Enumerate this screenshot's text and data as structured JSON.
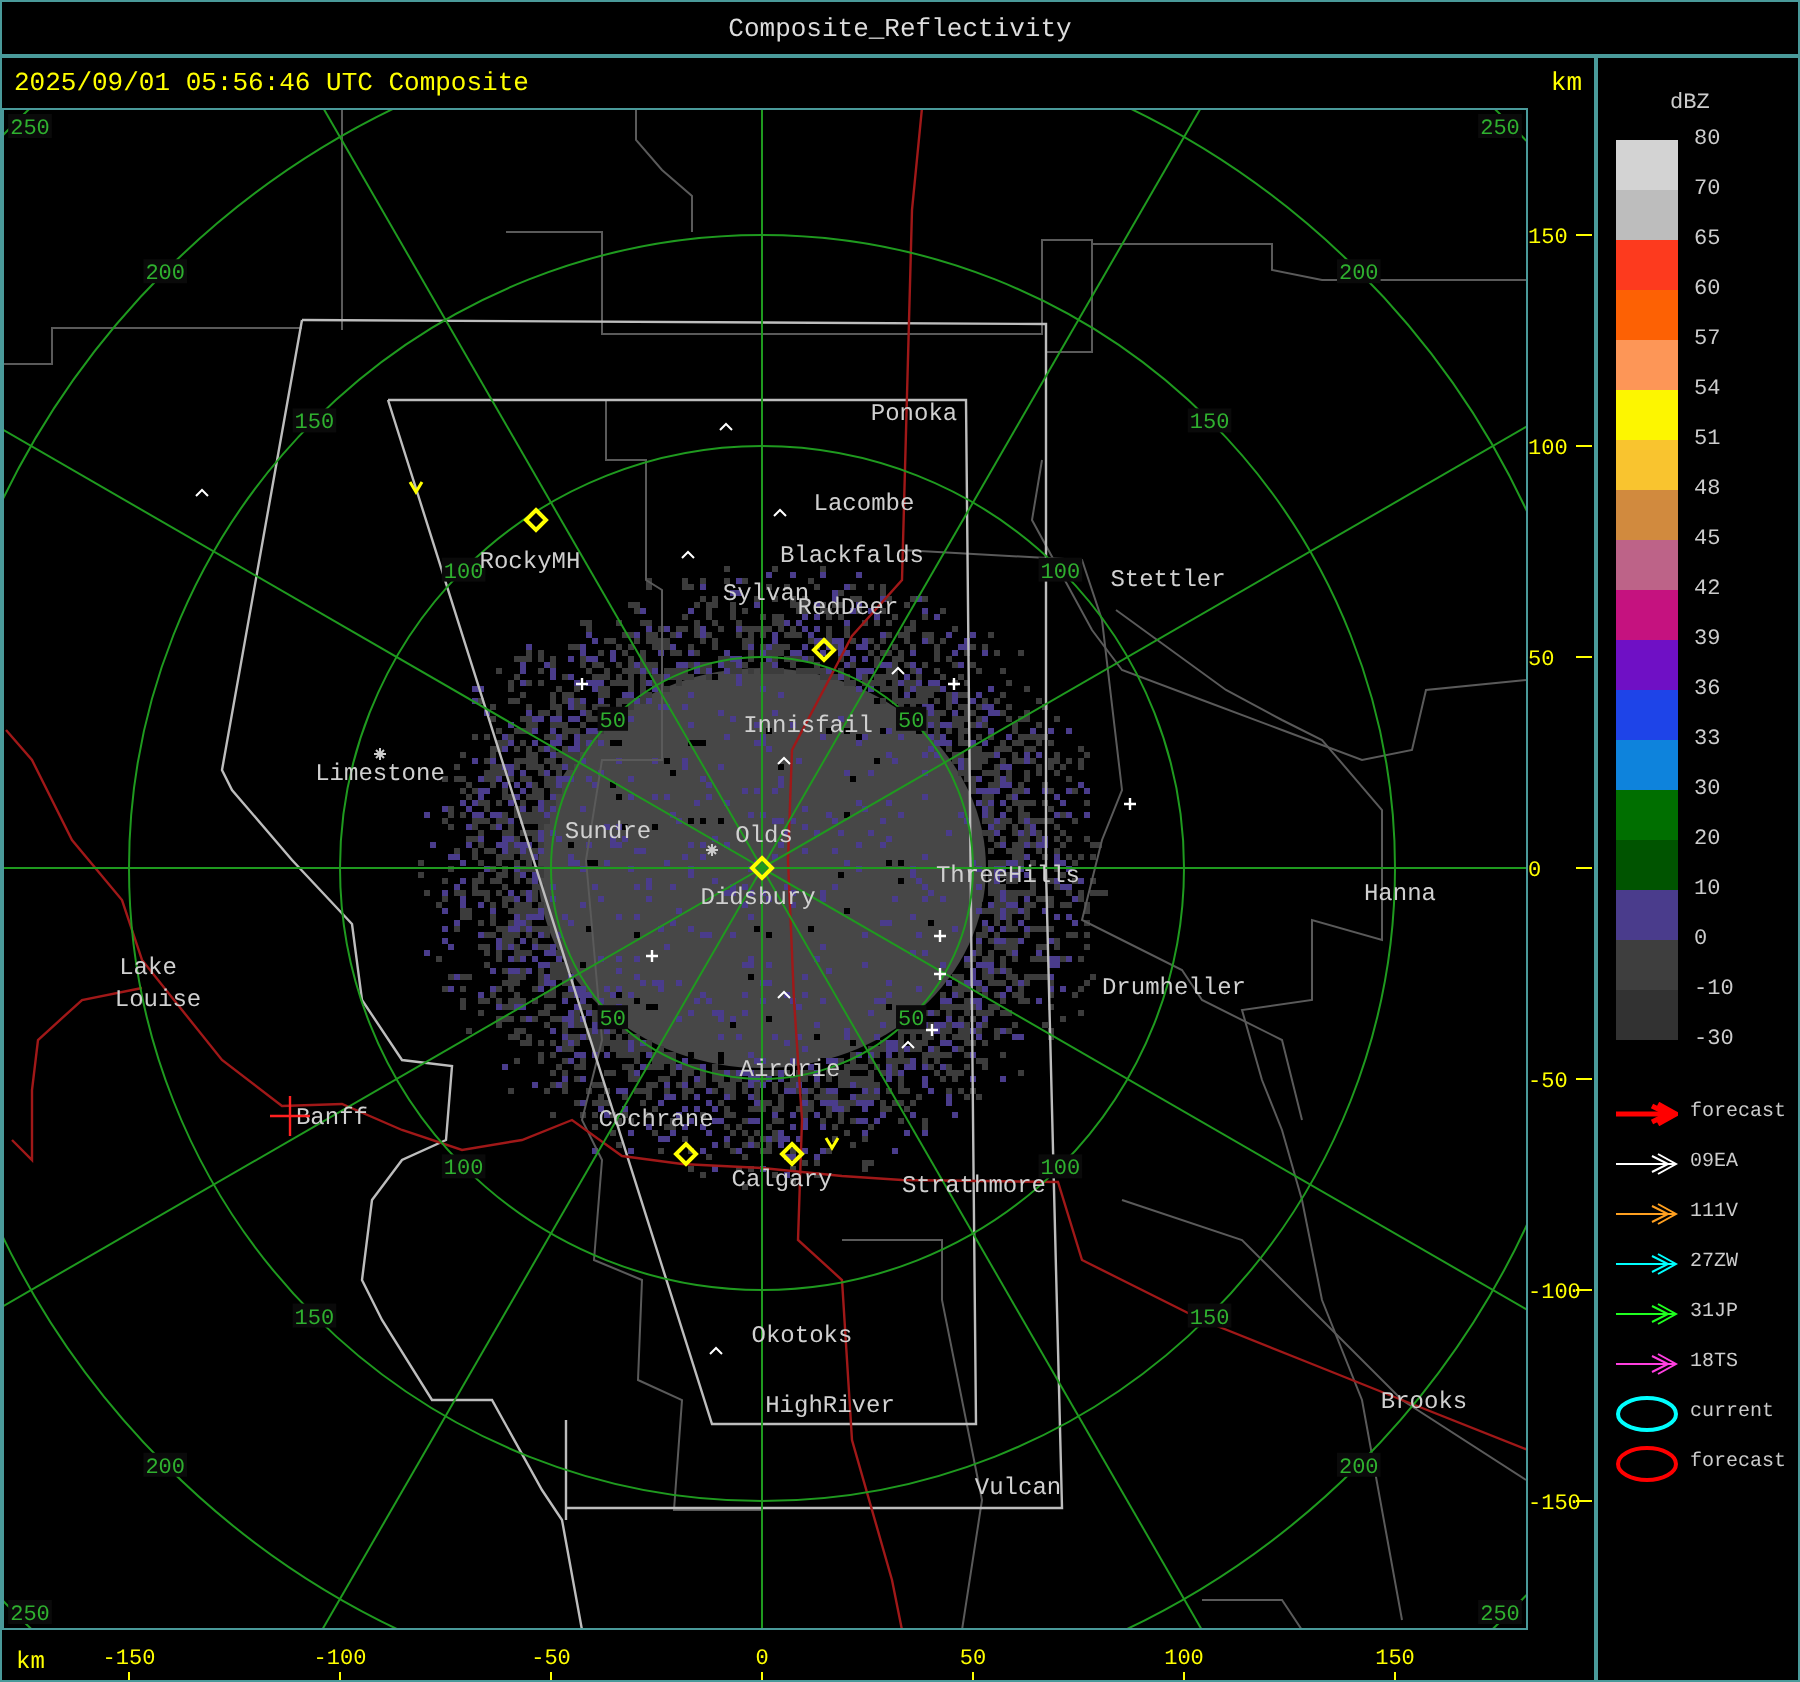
{
  "window": {
    "title": "Composite_Reflectivity"
  },
  "header": {
    "timestamp": "2025/09/01 05:56:46 UTC Composite",
    "axis_unit": "km"
  },
  "map": {
    "places": [
      "Ponoka",
      "Lacombe",
      "Blackfalds",
      "Sylvan",
      "RedDeer",
      "RockyMH",
      "Stettler",
      "Innisfail",
      "Limestone",
      "Sundre",
      "Olds",
      "Didsbury",
      "ThreeHills",
      "Hanna",
      "Lake",
      "Louise",
      "Drumheller",
      "Airdrie",
      "Banff",
      "Cochrane",
      "Calgary",
      "Strathmore",
      "Okotoks",
      "HighRiver",
      "Brooks",
      "Vulcan"
    ],
    "range_labels": [
      "50",
      "50",
      "50",
      "50",
      "100",
      "100",
      "100",
      "100",
      "150",
      "150",
      "150",
      "150",
      "200",
      "200",
      "200",
      "200",
      "250",
      "250",
      "250",
      "250"
    ]
  },
  "y_axis": {
    "ticks": [
      "150",
      "100",
      "50",
      "0",
      "-50",
      "-100",
      "-150"
    ]
  },
  "x_axis": {
    "unit": "km",
    "ticks": [
      "-150",
      "-100",
      "-50",
      "0",
      "50",
      "100",
      "150"
    ]
  },
  "legend": {
    "unit": "dBZ",
    "scale": [
      {
        "label": "80",
        "color": "#d3d3d3"
      },
      {
        "label": "70",
        "color": "#bdbdbd"
      },
      {
        "label": "65",
        "color": "#fd3a1e"
      },
      {
        "label": "60",
        "color": "#fd6104"
      },
      {
        "label": "57",
        "color": "#fd9657"
      },
      {
        "label": "54",
        "color": "#fdf600"
      },
      {
        "label": "51",
        "color": "#f9c42f"
      },
      {
        "label": "48",
        "color": "#d18a3e"
      },
      {
        "label": "45",
        "color": "#bd6388"
      },
      {
        "label": "42",
        "color": "#c5127f"
      },
      {
        "label": "39",
        "color": "#6f10c5"
      },
      {
        "label": "36",
        "color": "#1e44e8"
      },
      {
        "label": "33",
        "color": "#0e83dc"
      },
      {
        "label": "30",
        "color": "#006f00"
      },
      {
        "label": "20",
        "color": "#005400"
      },
      {
        "label": "10",
        "color": "#4a3c8c"
      },
      {
        "label": "0",
        "color": "#3e3e3e"
      },
      {
        "label": "-10",
        "color": "#323232"
      }
    ],
    "scale_end": "-30",
    "tracks": [
      {
        "kind": "arrow",
        "label": "forecast",
        "color": "#ff0000"
      },
      {
        "kind": "arrow",
        "label": "09EA",
        "color": "#ffffff"
      },
      {
        "kind": "arrow",
        "label": "111V",
        "color": "#ffa020"
      },
      {
        "kind": "arrow",
        "label": "27ZW",
        "color": "#00ffff"
      },
      {
        "kind": "arrow",
        "label": "31JP",
        "color": "#20ff20"
      },
      {
        "kind": "arrow",
        "label": "18TS",
        "color": "#ff40e0"
      },
      {
        "kind": "ellipse",
        "label": "current",
        "color": "#00ffff"
      },
      {
        "kind": "ellipse",
        "label": "forecast",
        "color": "#ff0000"
      }
    ]
  }
}
